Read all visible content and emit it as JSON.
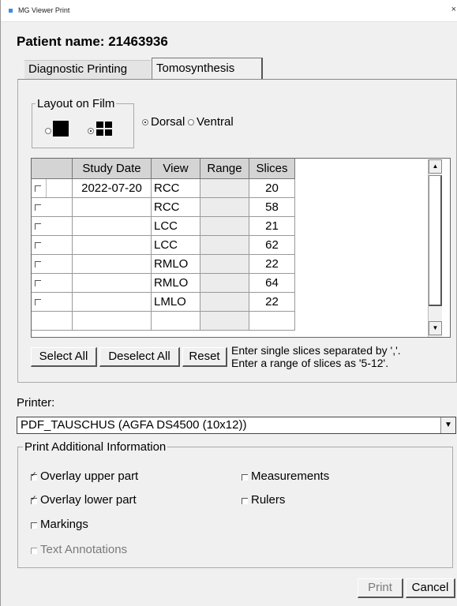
{
  "window": {
    "title": "MG Viewer Print",
    "close_glyph": "×"
  },
  "patient": {
    "label": "Patient name: 21463936"
  },
  "tabs": [
    {
      "label": "Diagnostic Printing",
      "active": false
    },
    {
      "label": "Tomosynthesis",
      "active": true
    }
  ],
  "layout": {
    "legend": "Layout on Film",
    "options": [
      {
        "icon": "single-square-icon",
        "selected": false
      },
      {
        "icon": "four-square-grid-icon",
        "selected": true
      }
    ],
    "orientation": [
      {
        "label": "Dorsal",
        "selected": true
      },
      {
        "label": "Ventral",
        "selected": false
      }
    ]
  },
  "table": {
    "columns": [
      "",
      "Study Date",
      "View",
      "Range",
      "Slices"
    ],
    "rows": [
      {
        "checked": false,
        "date": "2022-07-20",
        "view": "RCC",
        "range": "",
        "slices": "20"
      },
      {
        "checked": false,
        "date": "",
        "view": "RCC",
        "range": "",
        "slices": "58"
      },
      {
        "checked": false,
        "date": "",
        "view": "LCC",
        "range": "",
        "slices": "21"
      },
      {
        "checked": false,
        "date": "",
        "view": "LCC",
        "range": "",
        "slices": "62"
      },
      {
        "checked": false,
        "date": "",
        "view": "RMLO",
        "range": "",
        "slices": "22"
      },
      {
        "checked": false,
        "date": "",
        "view": "RMLO",
        "range": "",
        "slices": "64"
      },
      {
        "checked": false,
        "date": "",
        "view": "LMLO",
        "range": "",
        "slices": "22"
      }
    ]
  },
  "buttons": {
    "select_all": "Select All",
    "deselect_all": "Deselect All",
    "reset": "Reset",
    "print": "Print",
    "cancel": "Cancel"
  },
  "hints": {
    "line1": "Enter single slices separated by ','.",
    "line2": "Enter a range of slices as '5-12'."
  },
  "printer": {
    "label": "Printer:",
    "selected": "PDF_TAUSCHUS (AGFA DS4500 (10x12))"
  },
  "additional": {
    "legend": "Print Additional Information",
    "options": [
      {
        "label": "Overlay upper part",
        "checked": true,
        "enabled": true
      },
      {
        "label": "Overlay lower part",
        "checked": true,
        "enabled": true
      },
      {
        "label": "Markings",
        "checked": false,
        "enabled": true
      },
      {
        "label": "Text Annotations",
        "checked": false,
        "enabled": false
      },
      {
        "label": "Measurements",
        "checked": false,
        "enabled": true
      },
      {
        "label": "Rulers",
        "checked": false,
        "enabled": true
      }
    ]
  },
  "colors": {
    "title_icon": "#3c8ed8",
    "disabled_text": "#7a7a7a",
    "dialog_bg": "#f0f0f0"
  }
}
